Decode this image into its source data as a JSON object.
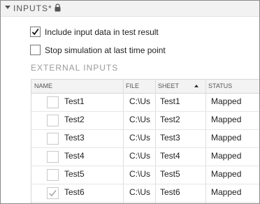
{
  "section": {
    "title": "INPUTS*"
  },
  "options": [
    {
      "label": "Include input data in test result",
      "checked": true
    },
    {
      "label": "Stop simulation at last time point",
      "checked": false
    }
  ],
  "external": {
    "title": "EXTERNAL INPUTS",
    "columns": {
      "name": "NAME",
      "file": "FILE",
      "sheet": "SHEET",
      "status": "STATUS"
    },
    "rows": [
      {
        "name": "Test1",
        "file": "C:\\Us",
        "sheet": "Test1",
        "status": "Mapped",
        "checked": false
      },
      {
        "name": "Test2",
        "file": "C:\\Us",
        "sheet": "Test2",
        "status": "Mapped",
        "checked": false
      },
      {
        "name": "Test3",
        "file": "C:\\Us",
        "sheet": "Test3",
        "status": "Mapped",
        "checked": false
      },
      {
        "name": "Test4",
        "file": "C:\\Us",
        "sheet": "Test4",
        "status": "Mapped",
        "checked": false
      },
      {
        "name": "Test5",
        "file": "C:\\Us",
        "sheet": "Test5",
        "status": "Mapped",
        "checked": false
      },
      {
        "name": "Test6",
        "file": "C:\\Us",
        "sheet": "Test6",
        "status": "Mapped",
        "checked": true
      }
    ]
  },
  "icons": {
    "collapse": "chevron-down-icon",
    "lock": "lock-icon",
    "sort": "sort-ascending-icon"
  },
  "colors": {
    "header_bg": "#f2f2f2",
    "table_header_bg": "#f3f3f3",
    "muted_text": "#9a9a9a"
  }
}
